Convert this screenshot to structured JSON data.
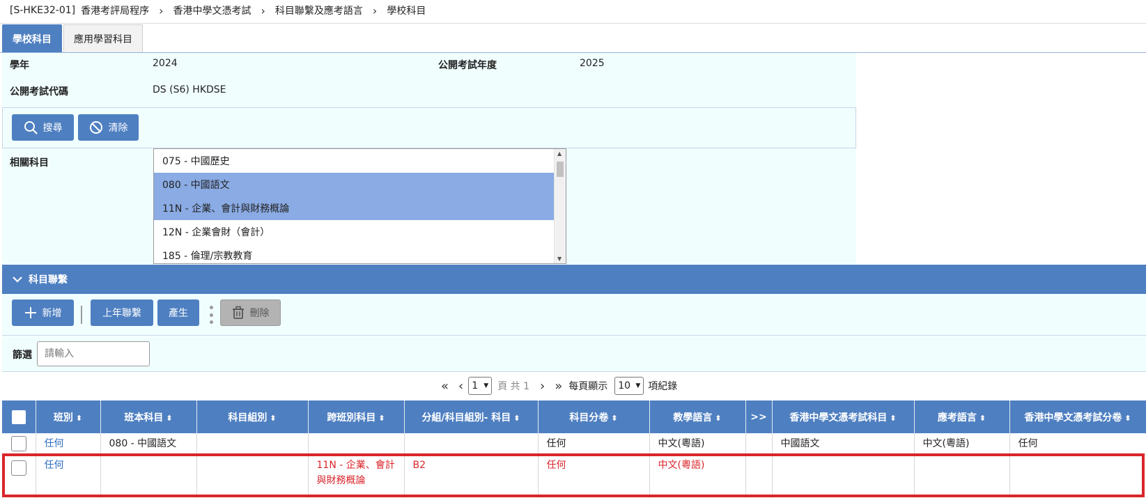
{
  "breadcrumb": {
    "code": "[S-HKE32-01]",
    "items": [
      "香港考評局程序",
      "香港中學文憑考試",
      "科目聯繫及應考語言",
      "學校科目"
    ]
  },
  "tabs": [
    {
      "label": "學校科目",
      "active": true
    },
    {
      "label": "應用學習科目",
      "active": false
    }
  ],
  "info": {
    "year_label": "學年",
    "year_value": "2024",
    "exam_year_label": "公開考試年度",
    "exam_year_value": "2025",
    "exam_code_label": "公開考試代碼",
    "exam_code_value": "DS (S6) HKDSE"
  },
  "search_buttons": {
    "search": "搜尋",
    "clear": "清除"
  },
  "related_subjects": {
    "label": "相關科目",
    "items": [
      {
        "text": "075 - 中國歷史",
        "selected": false
      },
      {
        "text": "080 - 中國語文",
        "selected": true
      },
      {
        "text": "11N - 企業、會計與財務概論",
        "selected": true
      },
      {
        "text": "12N - 企業會財（會計）",
        "selected": false
      },
      {
        "text": "185 - 倫理/宗教教育",
        "selected": false
      }
    ]
  },
  "section": {
    "title": "科目聯繫"
  },
  "actions": {
    "add": "新增",
    "last_year": "上年聯繫",
    "generate": "產生",
    "delete": "刪除"
  },
  "filter": {
    "label": "篩選",
    "placeholder": "請輸入",
    "value": ""
  },
  "pager": {
    "page": "1",
    "total_text": "頁 共 1",
    "per_page_label": "每頁顯示",
    "per_page": "10",
    "records_label": "項紀錄"
  },
  "table": {
    "columns": [
      "班別",
      "班本科目",
      "科目組別",
      "跨班別科目",
      "分組/科目組別- 科目",
      "科目分卷",
      "教學語言",
      ">>",
      "香港中學文憑考試科目",
      "應考語言",
      "香港中學文憑考試分卷"
    ],
    "rows": [
      {
        "class": "任何",
        "class_subject": "080 - 中國語文",
        "subject_group": "",
        "cross_class": "",
        "group_subject": "",
        "paper": "任何",
        "medium": "中文(粵語)",
        "more": "",
        "dse_subject": "中國語文",
        "exam_lang": "中文(粵語)",
        "dse_paper": "任何",
        "highlight": false
      },
      {
        "class": "任何",
        "class_subject": "",
        "subject_group": "",
        "cross_class": "11N - 企業、會計與財務概論",
        "group_subject": "B2",
        "paper": "任何",
        "medium": "中文(粵語)",
        "more": "",
        "dse_subject": "",
        "exam_lang": "",
        "dse_paper": "",
        "highlight": true
      }
    ]
  },
  "colors": {
    "primary": "#4e7fc1",
    "panel": "#f0fefe",
    "selected": "#8aabe4",
    "highlight": "#d9262b",
    "link": "#2a6bbf"
  }
}
